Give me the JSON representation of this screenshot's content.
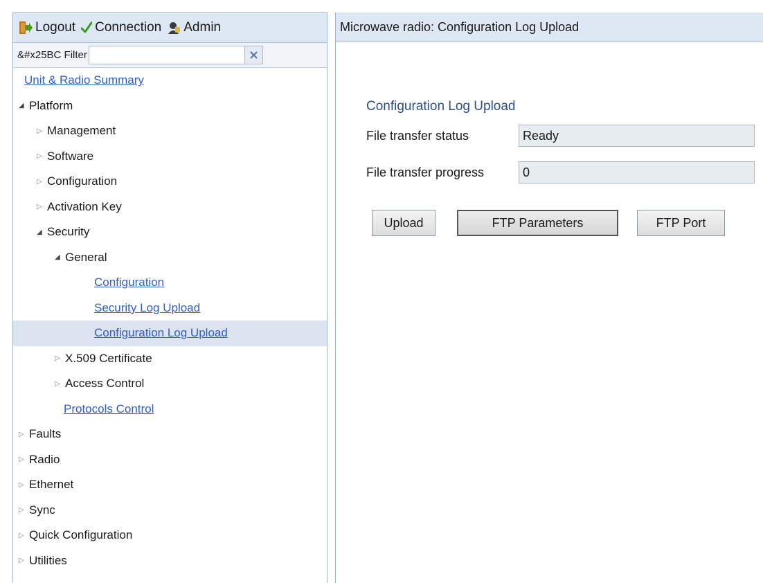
{
  "toolbar": {
    "logout_label": "Logout",
    "connection_label": "Connection",
    "admin_label": "Admin"
  },
  "filter": {
    "label": "&#x25BC Filter",
    "value": "",
    "placeholder": ""
  },
  "tree": {
    "unit_radio_summary": "Unit & Radio Summary",
    "platform": "Platform",
    "management": "Management",
    "software": "Software",
    "configuration": "Configuration",
    "activation_key": "Activation Key",
    "security": "Security",
    "general": "General",
    "general_configuration": "Configuration",
    "security_log_upload": "Security Log Upload",
    "configuration_log_upload": "Configuration Log Upload",
    "x509_certificate": "X.509 Certificate",
    "access_control": "Access Control",
    "protocols_control": "Protocols Control",
    "faults": "Faults",
    "radio": "Radio",
    "ethernet": "Ethernet",
    "sync": "Sync",
    "quick_configuration": "Quick Configuration",
    "utilities": "Utilities"
  },
  "main": {
    "header": "Microwave radio: Configuration Log Upload",
    "section_title": "Configuration Log Upload",
    "status_label": "File transfer status",
    "status_value": "Ready",
    "progress_label": "File transfer progress",
    "progress_value": "0",
    "upload_label": "Upload",
    "ftp_parameters_label": "FTP Parameters",
    "ftp_port_label": "FTP Port"
  },
  "colors": {
    "link": "#2f5ec8",
    "header_bg": "#dde8f4",
    "selected_bg": "#dbe4f0",
    "section_title": "#2e4f86",
    "check_green": "#3a9a1e"
  },
  "icons": {
    "logout": "logout-door-icon",
    "connection": "check-icon",
    "admin": "admin-user-icon",
    "clear": "close-icon",
    "expanded": "triangle-down-icon",
    "collapsed": "triangle-right-icon"
  }
}
